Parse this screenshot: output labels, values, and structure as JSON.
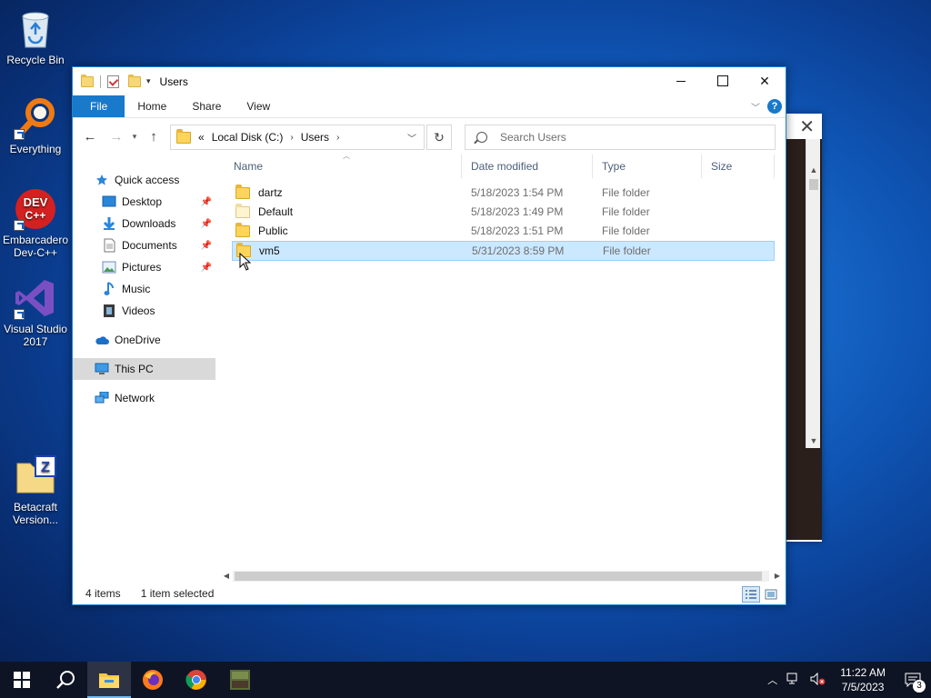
{
  "desktop": {
    "icons": [
      {
        "label": "Recycle Bin",
        "icon": "recycle-bin-icon"
      },
      {
        "label": "Everything",
        "icon": "everything-search-icon"
      },
      {
        "label": "Embarcadero Dev-C++",
        "icon": "devcpp-icon"
      },
      {
        "label": "Visual Studio 2017",
        "icon": "visual-studio-icon"
      },
      {
        "label": "Betacraft Version...",
        "icon": "betacraft-icon"
      }
    ]
  },
  "explorer": {
    "title": "Users",
    "ribbon": {
      "tabs": [
        "File",
        "Home",
        "Share",
        "View"
      ],
      "help": "?"
    },
    "address": {
      "prefix": "«",
      "crumbs": [
        "Local Disk (C:)",
        "Users"
      ]
    },
    "search": {
      "placeholder": "Search Users"
    },
    "nav": {
      "quick_access": "Quick access",
      "pinned": [
        "Desktop",
        "Downloads",
        "Documents",
        "Pictures"
      ],
      "unpinned": [
        "Music",
        "Videos"
      ],
      "onedrive": "OneDrive",
      "this_pc": "This PC",
      "network": "Network"
    },
    "columns": [
      "Name",
      "Date modified",
      "Type",
      "Size"
    ],
    "files": [
      {
        "name": "dartz",
        "date": "5/18/2023 1:54 PM",
        "type": "File folder",
        "selected": false
      },
      {
        "name": "Default",
        "date": "5/18/2023 1:49 PM",
        "type": "File folder",
        "selected": false
      },
      {
        "name": "Public",
        "date": "5/18/2023 1:51 PM",
        "type": "File folder",
        "selected": false
      },
      {
        "name": "vm5",
        "date": "5/31/2023 8:59 PM",
        "type": "File folder",
        "selected": true
      }
    ],
    "status": {
      "count": "4 items",
      "selection": "1 item selected"
    }
  },
  "taskbar": {
    "apps": [
      "windows-start-icon",
      "search-icon",
      "file-explorer-icon",
      "firefox-icon",
      "chrome-icon",
      "minecraft-icon"
    ],
    "time": "11:22 AM",
    "date": "7/5/2023",
    "notifications": "3"
  },
  "colors": {
    "accent": "#1979ca",
    "selection": "#cce8ff",
    "folder": "#ffd45a",
    "taskbar": "#0f1424"
  }
}
